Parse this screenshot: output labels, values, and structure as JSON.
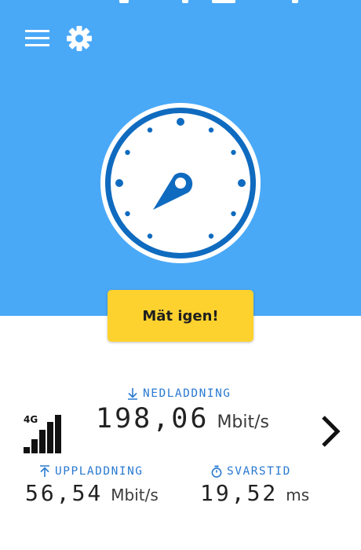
{
  "header": {
    "menu_icon": "hamburger-menu-icon",
    "settings_icon": "gear-icon"
  },
  "gauge": {
    "icon": "speedometer-dial-icon"
  },
  "cta": {
    "label": "Mät igen!"
  },
  "results": {
    "download": {
      "label": "NEDLADDNING",
      "value": "198,06",
      "unit": "Mbit/s",
      "icon": "arrow-down-icon"
    },
    "upload": {
      "label": "UPPLADDNING",
      "value": "56,54",
      "unit": "Mbit/s",
      "icon": "arrow-up-icon"
    },
    "latency": {
      "label": "SVARSTID",
      "value": "19,52",
      "unit": "ms",
      "icon": "stopwatch-icon"
    }
  },
  "network": {
    "technology": "4G",
    "icon": "signal-bars-icon"
  },
  "details": {
    "icon": "chevron-right-icon"
  },
  "colors": {
    "hero_bg": "#4aa9f7",
    "gauge_blue": "#0f6bbf",
    "cta_bg": "#fdd22f",
    "label_blue": "#2a7ad0"
  }
}
